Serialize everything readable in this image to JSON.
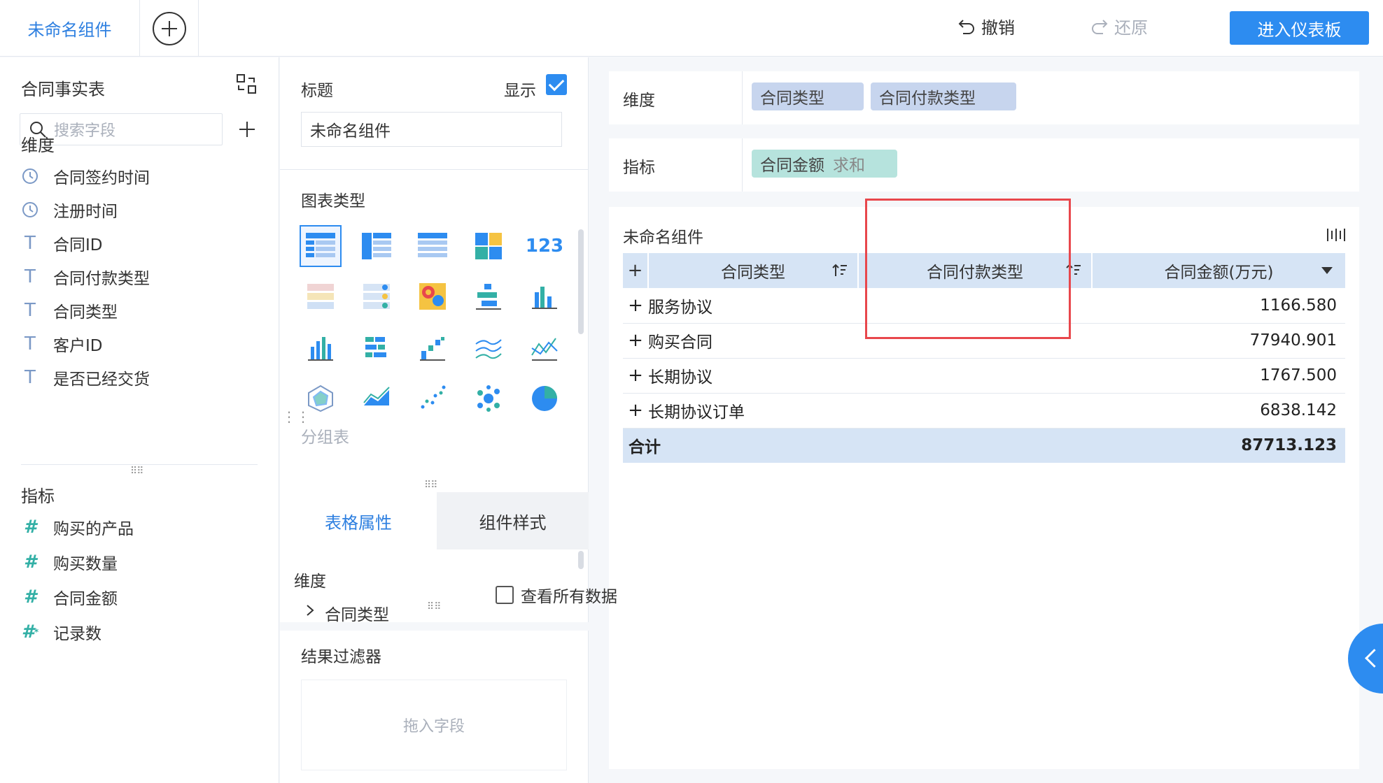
{
  "topbar": {
    "active_tab": "未命名组件",
    "undo": "撤销",
    "redo": "还原",
    "enter_dashboard": "进入仪表板"
  },
  "left": {
    "table_name": "合同事实表",
    "search_placeholder": "搜索字段",
    "dimension_title": "维度",
    "dimension_fields": [
      {
        "label": "合同签约时间",
        "icon": "clock-icon"
      },
      {
        "label": "注册时间",
        "icon": "clock-icon"
      },
      {
        "label": "合同ID",
        "icon": "text-type-icon"
      },
      {
        "label": "合同付款类型",
        "icon": "text-type-icon"
      },
      {
        "label": "合同类型",
        "icon": "text-type-icon"
      },
      {
        "label": "客户ID",
        "icon": "text-type-icon"
      },
      {
        "label": "是否已经交货",
        "icon": "text-type-icon"
      }
    ],
    "measure_title": "指标",
    "measure_fields": [
      {
        "label": "购买的产品",
        "icon": "number-type-icon"
      },
      {
        "label": "购买数量",
        "icon": "number-type-icon"
      },
      {
        "label": "合同金额",
        "icon": "number-type-icon"
      },
      {
        "label": "记录数",
        "icon": "computed-number-icon"
      }
    ]
  },
  "middle": {
    "title_label": "标题",
    "show_label": "显示",
    "title_value": "未命名组件",
    "chart_type_label": "图表类型",
    "chart_type_caption": "分组表",
    "tab_table_props": "表格属性",
    "tab_component_style": "组件样式",
    "props_dimension_title": "维度",
    "props_dimension_item": "合同类型",
    "result_filter": "结果过滤器",
    "drop_hint": "拖入字段"
  },
  "right": {
    "dim_label": "维度",
    "dim_pills": [
      "合同类型",
      "合同付款类型"
    ],
    "ind_label": "指标",
    "ind_pill": {
      "name": "合同金额",
      "agg": "求和"
    },
    "widget_title": "未命名组件",
    "table": {
      "headers": [
        "合同类型",
        "合同付款类型",
        "合同金额(万元)"
      ],
      "rows": [
        {
          "type": "服务协议",
          "value": "1166.580"
        },
        {
          "type": "购买合同",
          "value": "77940.901"
        },
        {
          "type": "长期协议",
          "value": "1767.500"
        },
        {
          "type": "长期协议订单",
          "value": "6838.142"
        }
      ],
      "total_label": "合计",
      "total_value": "87713.123"
    },
    "view_all": "查看所有数据"
  },
  "colors": {
    "accent": "#2d8cf0",
    "dim_pill": "#c7d5ee",
    "ind_pill": "#b6e3dd",
    "header_bg": "#d6e4f5",
    "highlight_border": "#e8474c"
  }
}
